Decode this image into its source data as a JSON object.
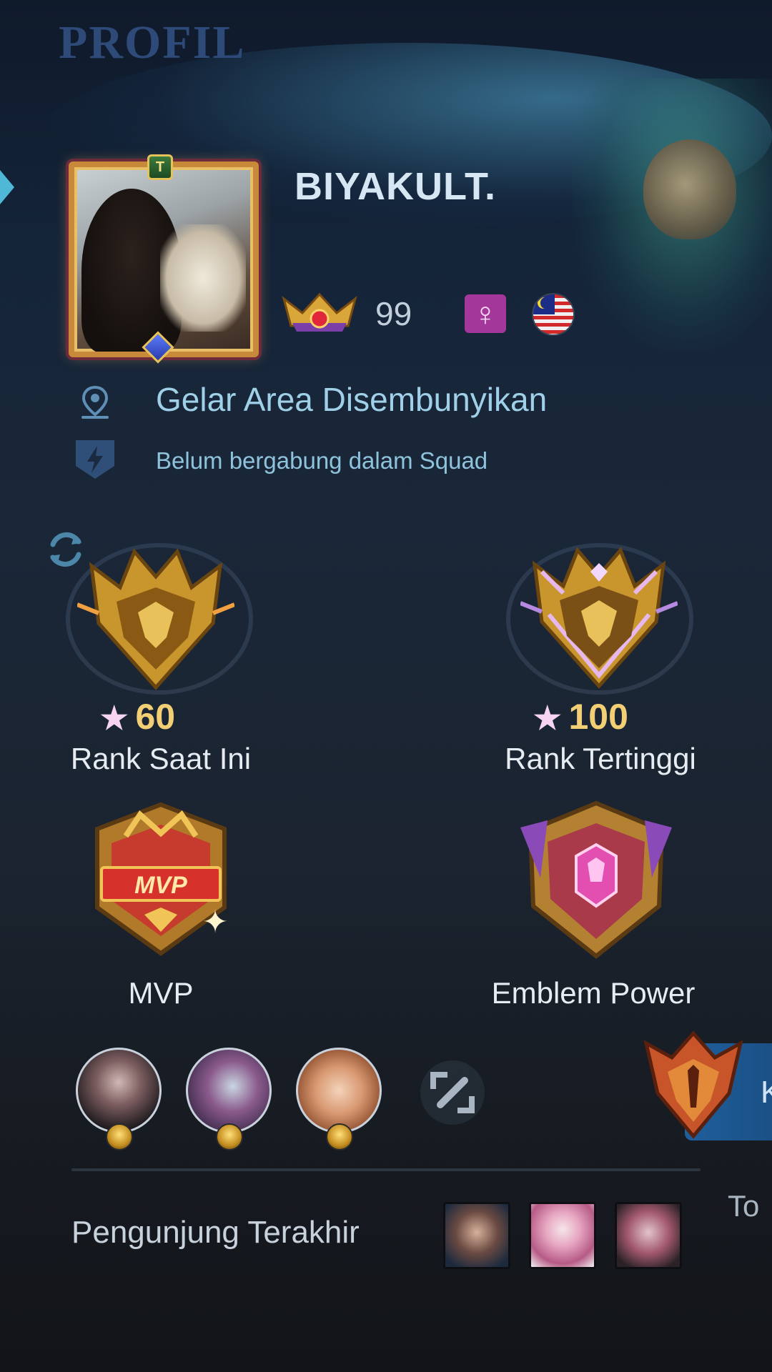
{
  "header": {
    "title": "PROFIL"
  },
  "player": {
    "name": "BIYAKULT.",
    "level": "99",
    "gender_icon": "female-icon",
    "country_flag": "malaysia-flag-icon"
  },
  "info": {
    "location": "Gelar Area Disembunyikan",
    "squad": "Belum bergabung dalam Squad"
  },
  "badges": {
    "current_rank": {
      "stars": "60",
      "label": "Rank Saat Ini"
    },
    "highest_rank": {
      "stars": "100",
      "label": "Rank Tertinggi"
    },
    "mvp": {
      "label": "MVP",
      "banner": "MVP"
    },
    "emblem": {
      "label": "Emblem Power"
    }
  },
  "side_panel": {
    "label": "K"
  },
  "visitors": {
    "label": "Pengunjung Terakhir",
    "total_label": "To"
  },
  "colors": {
    "accent": "#4fb8d6",
    "gold": "#f2cf74",
    "title": "#2e4a78",
    "gender": "#a4379a"
  }
}
